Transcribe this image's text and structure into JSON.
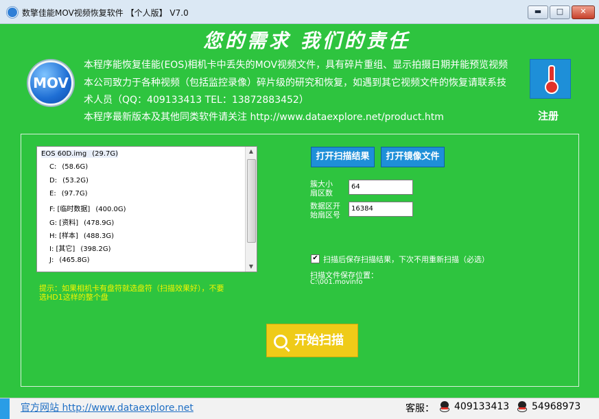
{
  "window": {
    "title": "数擎佳能MOV视频恢复软件 【个人版】 V7.0",
    "min_label": "▬",
    "max_label": "□",
    "close_label": "✕"
  },
  "header": {
    "slogan": "您的需求   我们的责任",
    "logo_text": "MOV",
    "desc_lines": [
      "本程序能恢复佳能(EOS)相机卡中丢失的MOV视频文件，具有碎片重组、显示拍摄日期并能预览视频",
      "本公司致力于各种视频（包括监控录像）碎片级的研究和恢复，如遇到其它视频文件的恢复请联系技",
      "术人员（QQ：409133413  TEL：13872883452）",
      "本程序最新版本及其他同类软件请关注 http://www.dataexplore.net/product.htm"
    ],
    "register_label": "注册",
    "register_icon": "thermometer-icon"
  },
  "drives": {
    "items": [
      {
        "name": "EOS 60D.img",
        "size": "(29.7G)"
      },
      {
        "name": "C:",
        "size": "(58.6G)"
      },
      {
        "name": "D:",
        "size": "(53.2G)"
      },
      {
        "name": "E:",
        "size": "(97.7G)"
      },
      {
        "name": "F:  [临时数据]",
        "size": "(400.0G)"
      },
      {
        "name": "G:  [资料]",
        "size": "(478.9G)"
      },
      {
        "name": "H:  [样本]",
        "size": "(488.3G)"
      },
      {
        "name": "I:  [其它]",
        "size": "(398.2G)"
      },
      {
        "name": "J:",
        "size": "(465.8G)"
      }
    ],
    "hint_lines": [
      "提示：如果相机卡有盘符就选盘符（扫描效果好），不要",
      "选HD1这样的整个盘"
    ]
  },
  "actions": {
    "open_scan_result": "打开扫描结果",
    "open_image_file": "打开镜像文件",
    "start_scan": "开始扫描"
  },
  "fields": {
    "cluster_label_1": "簇大小",
    "cluster_label_2": "扇区数",
    "cluster_value": "64",
    "data_start_label_1": "数据区开",
    "data_start_label_2": "始扇区号",
    "data_start_value": "16384"
  },
  "options": {
    "save_results_checked": true,
    "check_mark": "✔",
    "save_results_label": "扫描后保存扫描结果，下次不用重新扫描（必选）",
    "save_location_label": "扫描文件保存位置：",
    "save_location_path": "C:\\001.movinfo"
  },
  "footer": {
    "site_label": "官方网站 http://www.dataexplore.net",
    "service_label": "客服：",
    "qq1": "409133413",
    "qq2": "54968973"
  },
  "colors": {
    "background": "#2ec43f",
    "accent_blue": "#1e8fd8",
    "start_yellow": "#efcb18",
    "hint_yellow": "#f4f400"
  }
}
